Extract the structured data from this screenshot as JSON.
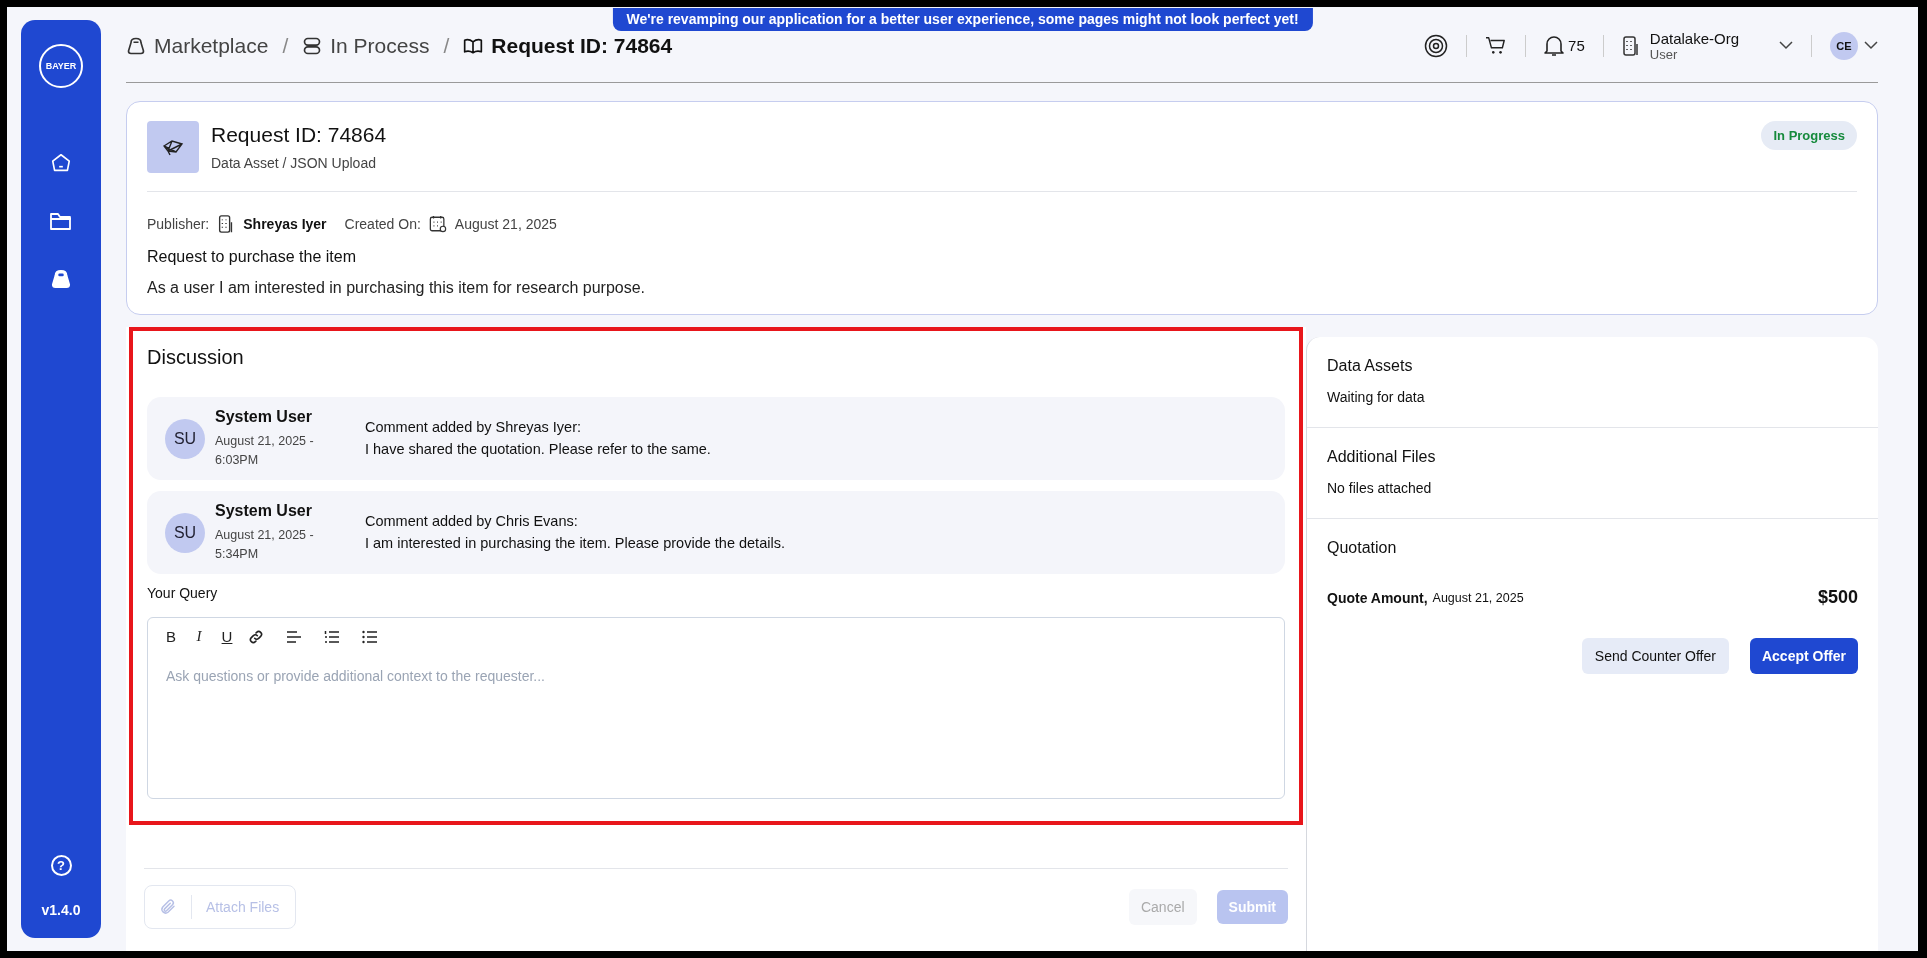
{
  "banner": "We're revamping our application for a better user experience, some pages might not look perfect yet!",
  "sidebar": {
    "logo": "BAYER",
    "items": [
      {
        "kind": "home",
        "selected": false
      },
      {
        "kind": "folder",
        "selected": false
      },
      {
        "kind": "bag",
        "selected": true
      }
    ],
    "version": "v1.4.0"
  },
  "breadcrumb_separator": "/",
  "help": "?",
  "breadcrumb": [
    {
      "kind": "bag",
      "label": "Marketplace",
      "selected": false
    },
    {
      "kind": "stack",
      "label": "In Process",
      "selected": false
    },
    {
      "kind": "book",
      "label": "Request ID: 74864",
      "selected": true
    }
  ],
  "header": {
    "notifications": "75",
    "org": "Datalake-Org",
    "role": "User",
    "avatar": "CE"
  },
  "request": {
    "title": "Request ID: 74864",
    "subtitle": "Data Asset / JSON Upload",
    "status": "In Progress",
    "publisher_label": "Publisher:",
    "publisher": "Shreyas Iyer",
    "created_label": "Created On:",
    "created": "August 21, 2025",
    "heading": "Request to purchase the item",
    "description": "As a user I am interested in purchasing this item for research purpose."
  },
  "discussion": {
    "highlighted": true,
    "title": "Discussion",
    "comments": [
      {
        "avatar": "SU",
        "author": "System User",
        "date": "August 21, 2025 - 6:03PM",
        "byline": "Comment added by Shreyas Iyer:",
        "text": "I have shared the quotation. Please refer to the same."
      },
      {
        "avatar": "SU",
        "author": "System User",
        "date": "August 21, 2025 - 5:34PM",
        "byline": "Comment added by Chris Evans:",
        "text": "I am interested in purchasing the item. Please provide the details."
      }
    ],
    "query_label": "Your Query",
    "toolbar": [
      {
        "kind": "bold",
        "label": "B"
      },
      {
        "kind": "italic",
        "label": "I"
      },
      {
        "kind": "underline",
        "label": "U"
      },
      {
        "kind": "link"
      },
      {
        "kind": "align"
      },
      {
        "kind": "ordered"
      },
      {
        "kind": "bullet"
      }
    ],
    "placeholder": "Ask questions or provide additional context to the requester..."
  },
  "footer": {
    "attach": {
      "label": "Attach Files",
      "disabled": true
    },
    "cancel": {
      "label": "Cancel",
      "disabled": true
    },
    "submit": {
      "label": "Submit",
      "disabled": true
    }
  },
  "side": {
    "sections": [
      {
        "title": "Data Assets",
        "text": "Waiting for data"
      },
      {
        "title": "Additional Files",
        "text": "No files attached"
      }
    ],
    "quotation": {
      "title": "Quotation",
      "label": "Quote Amount,",
      "date": "August 21, 2025",
      "amount": "$500",
      "counter": "Send Counter Offer",
      "accept": "Accept Offer"
    }
  }
}
